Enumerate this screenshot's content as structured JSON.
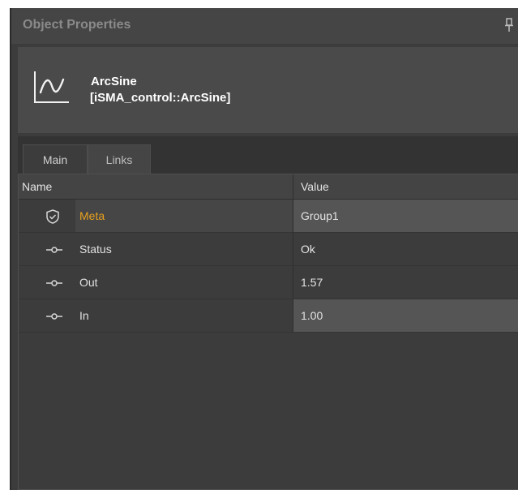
{
  "panel": {
    "title": "Object Properties",
    "pin_icon": "pin-icon"
  },
  "object": {
    "icon": "arcsine-wave-icon",
    "name": "ArcSine",
    "type": "[iSMA_control::ArcSine]"
  },
  "tabs": [
    {
      "label": "Main",
      "active": true
    },
    {
      "label": "Links",
      "active": false
    }
  ],
  "grid": {
    "columns": {
      "name": "Name",
      "value": "Value"
    },
    "rows": [
      {
        "icon": "shield-check-icon",
        "name": "Meta",
        "value": "Group1"
      },
      {
        "icon": "slot-link-icon",
        "name": "Status",
        "value": "Ok"
      },
      {
        "icon": "slot-link-icon",
        "name": "Out",
        "value": "1.57"
      },
      {
        "icon": "slot-link-icon",
        "name": "In",
        "value": "1.00"
      }
    ]
  },
  "colors": {
    "panel_bg": "#3c3c3c",
    "meta_accent": "#e8a01e",
    "text": "#e4e4e4"
  }
}
